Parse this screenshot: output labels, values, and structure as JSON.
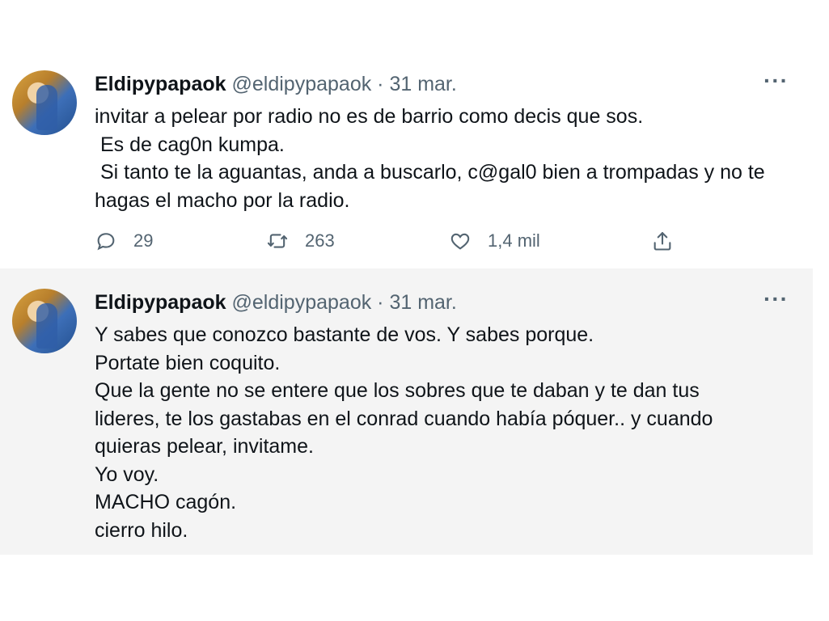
{
  "tweets": [
    {
      "name": "Eldipypapaok",
      "handle": "@eldipypapaok",
      "separator": "·",
      "date": "31 mar.",
      "more": "···",
      "lines": [
        "invitar a pelear por radio no es de barrio como decis que sos.",
        " Es de cag0n kumpa.",
        " Si tanto te la aguantas, anda a buscarlo, c@gal0 bien a trompadas y no te",
        "hagas el macho por la radio."
      ],
      "replies": "29",
      "retweets": "263",
      "likes": "1,4 mil"
    },
    {
      "name": "Eldipypapaok",
      "handle": "@eldipypapaok",
      "separator": "·",
      "date": "31 mar.",
      "more": "···",
      "lines": [
        "Y sabes que conozco bastante de vos. Y sabes porque.",
        "Portate bien coquito.",
        "Que la gente no se entere que los sobres que te daban y te dan tus",
        "lideres, te los gastabas en el conrad cuando había póquer.. y cuando",
        "quieras pelear, invitame.",
        "Yo voy.",
        "MACHO cagón.",
        "cierro hilo."
      ]
    }
  ],
  "icons": {
    "reply": "reply-icon",
    "retweet": "retweet-icon",
    "like": "heart-icon",
    "share": "share-icon"
  }
}
